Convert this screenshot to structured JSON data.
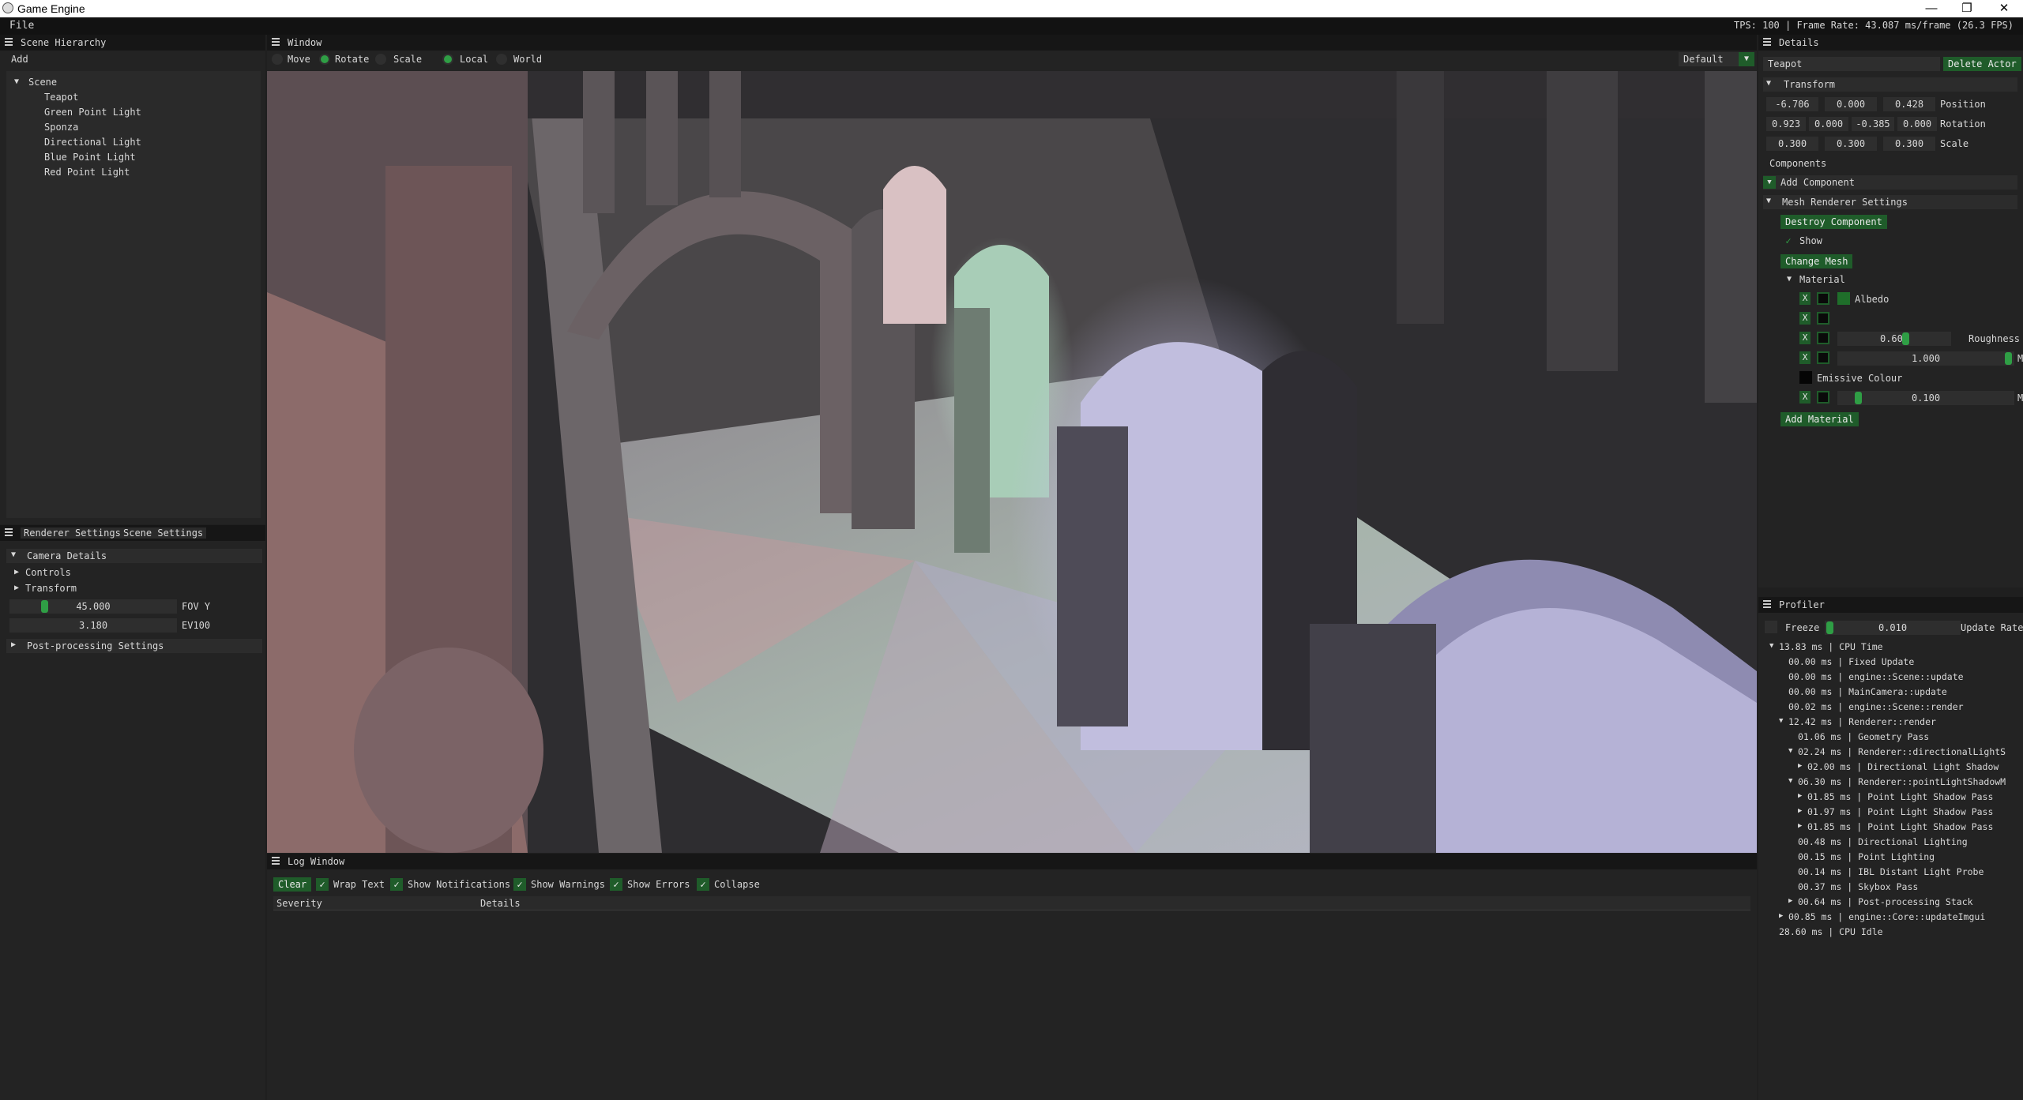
{
  "window": {
    "title": "Game Engine",
    "minimize": "—",
    "maximize": "❐",
    "close": "✕"
  },
  "menubar": {
    "file": "File",
    "stats": "TPS: 100 | Frame Rate: 43.087 ms/frame (26.3 FPS)"
  },
  "hierarchy": {
    "title": "Scene Hierarchy",
    "add": "Add",
    "root": "Scene",
    "items": [
      "Teapot",
      "Green Point Light",
      "Sponza",
      "Directional Light",
      "Blue Point Light",
      "Red Point Light"
    ]
  },
  "settings": {
    "tabs": [
      "Renderer Settings",
      "Scene Settings"
    ],
    "camera_details": "Camera Details",
    "controls": "Controls",
    "transform": "Transform",
    "fov_value": "45.000",
    "fov_label": "FOV Y",
    "ev_value": "3.180",
    "ev_label": "EV100",
    "postprocessing": "Post-processing Settings"
  },
  "viewport_window": {
    "title": "Window",
    "modes": [
      {
        "label": "Move",
        "selected": false
      },
      {
        "label": "Rotate",
        "selected": true
      },
      {
        "label": "Scale",
        "selected": false
      },
      {
        "label": "Local",
        "selected": true
      },
      {
        "label": "World",
        "selected": false
      }
    ],
    "camera_select": "Default"
  },
  "details": {
    "title": "Details",
    "actor_name": "Teapot",
    "delete_actor": "Delete Actor",
    "transform": "Transform",
    "position": [
      "-6.706",
      "0.000",
      "0.428"
    ],
    "position_label": "Position",
    "rotation": [
      "0.923",
      "0.000",
      "-0.385",
      "0.000"
    ],
    "rotation_label": "Rotation",
    "scale": [
      "0.300",
      "0.300",
      "0.300"
    ],
    "scale_label": "Scale",
    "components": "Components",
    "add_component": "Add Component",
    "mesh_renderer": "Mesh Renderer Settings",
    "destroy_component": "Destroy Component",
    "show": "Show",
    "change_mesh": "Change Mesh",
    "material": "Material",
    "x": "X",
    "albedo": "Albedo",
    "roughness_value": "0.600",
    "roughness": "Roughness",
    "metallic_value": "1.000",
    "emissive": "Emissive Colour",
    "emissive_value": "0.100",
    "add_material": "Add Material",
    "cut_label": "M"
  },
  "profiler": {
    "title": "Profiler",
    "freeze": "Freeze",
    "rate_value": "0.010",
    "rate_label": "Update Rate",
    "rows": [
      {
        "indent": 0,
        "arrow": "▼",
        "text": "13.83 ms | CPU Time"
      },
      {
        "indent": 1,
        "arrow": "",
        "text": "00.00 ms | Fixed Update"
      },
      {
        "indent": 1,
        "arrow": "",
        "text": "00.00 ms | engine::Scene::update"
      },
      {
        "indent": 1,
        "arrow": "",
        "text": "00.00 ms | MainCamera::update"
      },
      {
        "indent": 1,
        "arrow": "",
        "text": "00.02 ms | engine::Scene::render"
      },
      {
        "indent": 1,
        "arrow": "▼",
        "text": "12.42 ms | Renderer::render"
      },
      {
        "indent": 2,
        "arrow": "",
        "text": "01.06 ms | Geometry Pass"
      },
      {
        "indent": 2,
        "arrow": "▼",
        "text": "02.24 ms | Renderer::directionalLightS"
      },
      {
        "indent": 3,
        "arrow": "▶",
        "text": "02.00 ms | Directional Light Shadow"
      },
      {
        "indent": 2,
        "arrow": "▼",
        "text": "06.30 ms | Renderer::pointLightShadowM"
      },
      {
        "indent": 3,
        "arrow": "▶",
        "text": "01.85 ms | Point Light Shadow Pass"
      },
      {
        "indent": 3,
        "arrow": "▶",
        "text": "01.97 ms | Point Light Shadow Pass"
      },
      {
        "indent": 3,
        "arrow": "▶",
        "text": "01.85 ms | Point Light Shadow Pass"
      },
      {
        "indent": 2,
        "arrow": "",
        "text": "00.48 ms | Directional Lighting"
      },
      {
        "indent": 2,
        "arrow": "",
        "text": "00.15 ms | Point Lighting"
      },
      {
        "indent": 2,
        "arrow": "",
        "text": "00.14 ms | IBL Distant Light Probe"
      },
      {
        "indent": 2,
        "arrow": "",
        "text": "00.37 ms | Skybox Pass"
      },
      {
        "indent": 2,
        "arrow": "▶",
        "text": "00.64 ms | Post-processing Stack"
      },
      {
        "indent": 1,
        "arrow": "▶",
        "text": "00.85 ms | engine::Core::updateImgui"
      },
      {
        "indent": 0,
        "arrow": "",
        "text": "28.60 ms | CPU Idle"
      }
    ]
  },
  "log": {
    "title": "Log Window",
    "clear": "Clear",
    "options": [
      "Wrap Text",
      "Show Notifications",
      "Show Warnings",
      "Show Errors",
      "Collapse"
    ],
    "col_severity": "Severity",
    "col_details": "Details"
  },
  "colors": {
    "accent_green": "#2f9e45",
    "button_green": "#1f5c2a",
    "panel_bg": "#232323",
    "header_bg": "#161616"
  }
}
